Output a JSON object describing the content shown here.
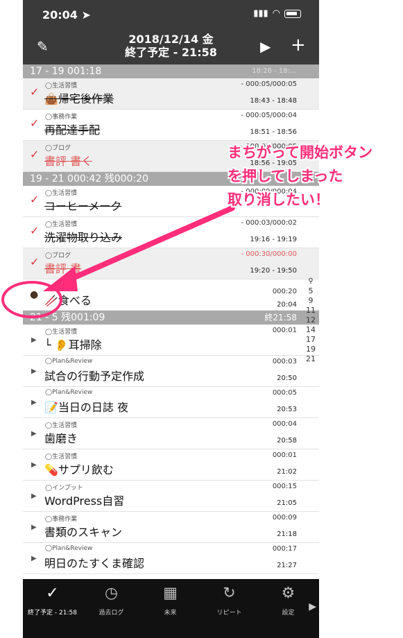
{
  "status": {
    "time": "20:04 ➤"
  },
  "nav": {
    "date": "2018/12/14 金",
    "end_plan": "終了予定 - 21:58"
  },
  "sections": [
    {
      "label": "17 - 19   001:18",
      "right": "18:26 - 18:…"
    },
    {
      "label": "19 - 21   000:42 残000:20",
      "right": ""
    },
    {
      "label": "21 - 5   残001:09",
      "right": "終21:58"
    }
  ],
  "rows": [
    {
      "cat": "◯生活習慣",
      "est": "- 000:05/000:05",
      "title": "👜帰宅後作業",
      "times": "18:43 - 18:48",
      "done": true
    },
    {
      "cat": "◯事務作業",
      "est": "- 000:05/000:04",
      "title": "再配達手配",
      "times": "18:51 - 18:56",
      "done": true
    },
    {
      "cat": "◯ブログ",
      "est": "- 000:05/000:05",
      "title": "書評 書く",
      "times": "18:56 - 19:05",
      "done": true
    },
    {
      "cat": "◯生活習慣",
      "est": "- 000:09/000:04",
      "title": "コーヒーメーク",
      "times": "",
      "done": true
    },
    {
      "cat": "◯生活習慣",
      "est": "- 000:03/000:02",
      "title": "洗濯物取り込み",
      "times": "19:16 - 19:19",
      "done": true
    },
    {
      "cat": "◯ブログ",
      "est": "- 000:30/000:00",
      "title": "書評 書",
      "times": "19:20 - 19:50",
      "done": true
    },
    {
      "cat": "",
      "est": "000:20",
      "title": "🥢食べる",
      "times": "20:04",
      "done": false
    },
    {
      "cat": "◯生活習慣",
      "est": "000:01",
      "title": "└ 👂耳掃除",
      "times": "",
      "done": false
    },
    {
      "cat": "◯Plan&Review",
      "est": "000:03",
      "title": "試合の行動予定作成",
      "times": "20:50",
      "done": false
    },
    {
      "cat": "◯Plan&Review",
      "est": "000:05",
      "title": "📝当日の日誌 夜",
      "times": "20:53",
      "done": false
    },
    {
      "cat": "◯生活習慣",
      "est": "000:04",
      "title": "歯磨き",
      "times": "20:58",
      "done": false
    },
    {
      "cat": "◯生活習慣",
      "est": "000:01",
      "title": "💊サプリ飲む",
      "times": "21:02",
      "done": false
    },
    {
      "cat": "◯インプット",
      "est": "000:15",
      "title": "WordPress自習",
      "times": "21:05",
      "done": false
    },
    {
      "cat": "◯事務作業",
      "est": "000:09",
      "title": "書類のスキャン",
      "times": "21:18",
      "done": false
    },
    {
      "cat": "◯Plan&Review",
      "est": "000:17",
      "title": "明日のたすくま確認",
      "times": "21:27",
      "done": false
    }
  ],
  "index": [
    "5",
    "9",
    "11",
    "12",
    "14",
    "17",
    "19",
    "21"
  ],
  "tabs": [
    {
      "label": "終了予定 - 21:58",
      "icon": "check-icon"
    },
    {
      "label": "過去ログ",
      "icon": "clock-icon"
    },
    {
      "label": "未来",
      "icon": "calendar-icon"
    },
    {
      "label": "リピート",
      "icon": "repeat-icon"
    },
    {
      "label": "設定",
      "icon": "gear-icon"
    }
  ],
  "annotation": {
    "line1": "まちがって開始ボタン",
    "line2": "を押してしまった",
    "line3": "取り消したい！"
  },
  "colors": {
    "accent": "#ff2d7a",
    "done_check": "#d9383a",
    "header": "#3a3a3a",
    "section": "#a9a9a9"
  }
}
